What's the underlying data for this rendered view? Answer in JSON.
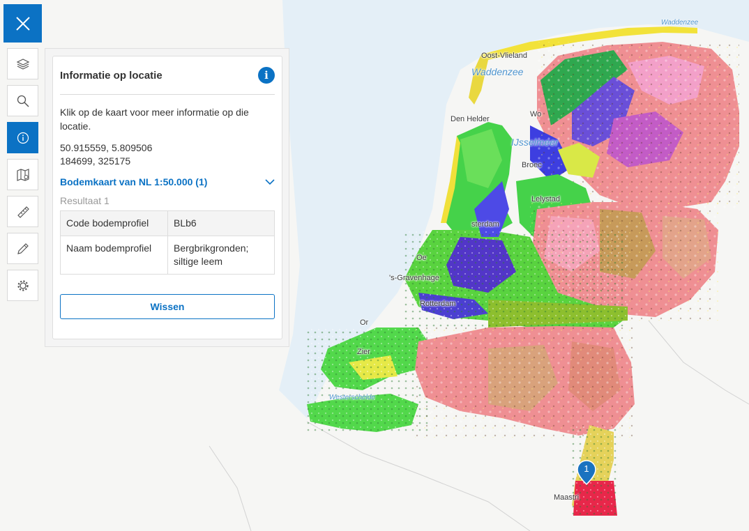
{
  "panel": {
    "title": "Informatie op locatie",
    "intro": "Klik op de kaart voor meer informatie op die locatie.",
    "coords_latlon": "50.915559, 5.809506",
    "coords_rd": "184699, 325175",
    "layer_title": "Bodemkaart van NL 1:50.000 (1)",
    "result_label": "Resultaat 1",
    "attributes": [
      {
        "key": "Code bodemprofiel",
        "value": "BLb6"
      },
      {
        "key": "Naam bodemprofiel",
        "value": "Bergbrikgronden; siltige leem"
      }
    ],
    "clear_label": "Wissen"
  },
  "toolbar": {
    "buttons": [
      "layers-icon",
      "search-icon",
      "info-icon",
      "map-legend-icon",
      "ruler-icon",
      "pencil-icon",
      "settings-icon"
    ],
    "active": "info-icon"
  },
  "map": {
    "marker_number": "1",
    "water_labels": {
      "waddenzee": "Waddenzee",
      "ijsselmeer": "IJsselmeer",
      "waddenzee_small": "Waddenzee",
      "westerschelde": "Westerschelde"
    },
    "place_labels": {
      "oost_vlieland": "Oost-Vlieland",
      "den_helder": "Den Helder",
      "broec": "Broec",
      "lelystad": "Lelystad",
      "msterdam": "sterdam",
      "s_gravenhage": "'s-Gravenhage",
      "rotterdam": "Rotterdam",
      "maastricht": "Maastri",
      "wo": "Wo",
      "oe": "Oe",
      "or": "Or",
      "zier": "Zier"
    }
  },
  "colors": {
    "accent": "#0b72c4",
    "sea": "#e4eff7",
    "land": "#f6f6f4"
  }
}
